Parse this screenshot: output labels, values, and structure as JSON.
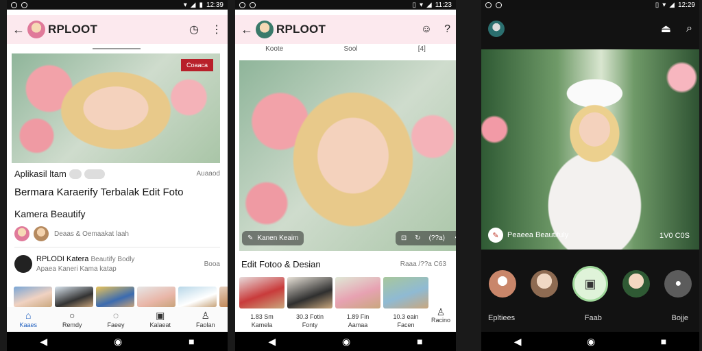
{
  "status": {
    "time": "12:39",
    "time2": "11:23",
    "time3": "12:29"
  },
  "p1": {
    "app_title": "RPLOOT",
    "hero_badge": "Coaaca",
    "meta_left": "Aplikasil ltam",
    "meta_right": "Auaaod",
    "headline": "Bermara Karaerify Terbalak Edit Foto",
    "subheadline": "Kamera Beautify",
    "byline": "Deaas & Oemaakat laah",
    "feed_title": "RPLODI Katera",
    "feed_title_tail": "Beautify Bodly",
    "feed_sub": "Apaea Kaneri Kama katap",
    "feed_right": "Booa",
    "nav": [
      "Kaaes",
      "Remdy",
      "Faeey",
      "Kalaeat",
      "Faolan"
    ]
  },
  "p2": {
    "app_title": "RPLOOT",
    "tabs": [
      "Koote",
      "Sool",
      "[4]"
    ],
    "overlay_label": "Kanen Keaim",
    "overlay_right": "(??a)",
    "section_title": "Edit Fotoo & Desian",
    "section_right": "Raaa /??a C63",
    "captions": [
      {
        "top": "1.83 Sm",
        "bottom": "Kamela"
      },
      {
        "top": "30.3 Fotin",
        "bottom": "Fonty"
      },
      {
        "top": "1.89 Fin",
        "bottom": "Aamaa"
      },
      {
        "top": "10.3 eain",
        "bottom": "Facen"
      }
    ],
    "nav_last": "Racino"
  },
  "p3": {
    "filter_label": "Peaeea Beautifuly",
    "filter_right": "1V0 C0S",
    "bottom_left": "Epltiees",
    "bottom_mid": "Faab",
    "bottom_right": "Bojje",
    "colors": {
      "shutter_ring": "#9fd89a"
    }
  }
}
